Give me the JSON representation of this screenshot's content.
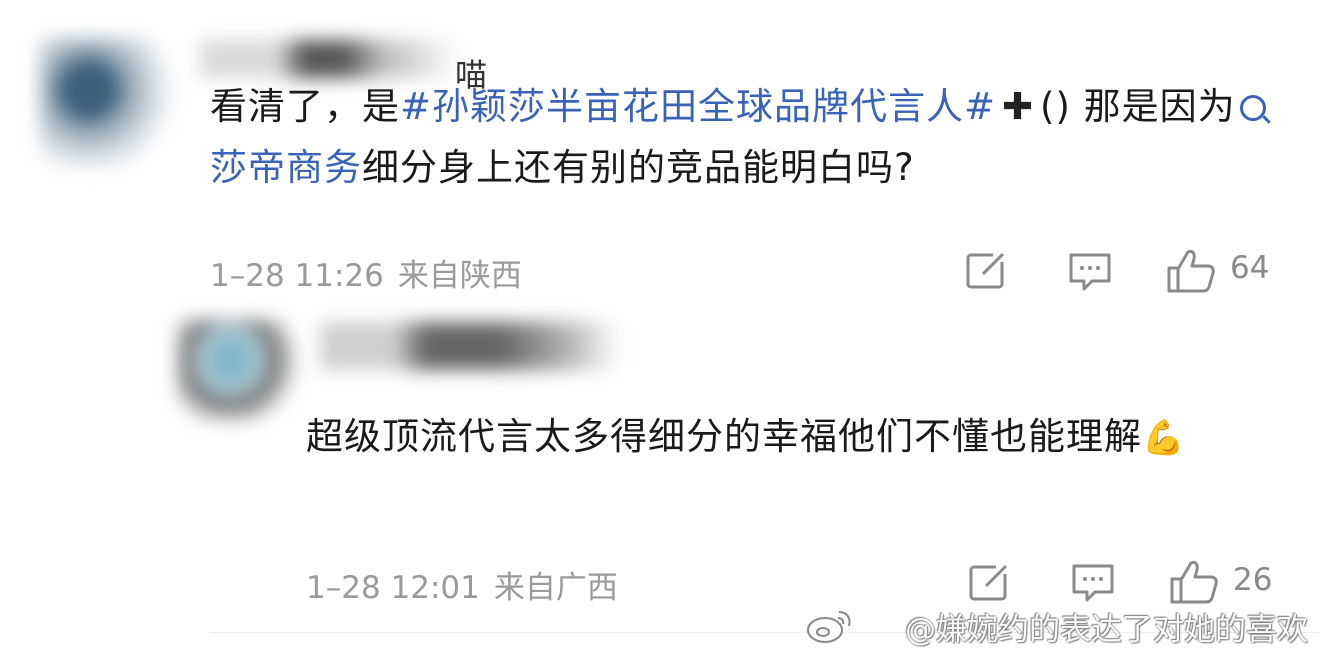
{
  "comments": [
    {
      "username_partial": "喵",
      "text_segments": {
        "prefix": "看清了，是",
        "hashtag": "#孙颖莎半亩花田全球品牌代言人#",
        "plus": "✚",
        "mid": "() 那是因为",
        "search_term": "莎帝商务",
        "suffix": "细分身上还有别的竞品能明白吗?"
      },
      "date": "1–28 11:26",
      "location": "来自陕西",
      "like_count": "64"
    },
    {
      "text": "超级顶流代言太多得细分的幸福他们不懂也能理解",
      "emoji": "💪",
      "date": "1–28 12:01",
      "location": "来自广西",
      "like_count": "26"
    }
  ],
  "watermark": "@嫌婉约的表达了对她的喜欢",
  "icons": [
    "share-icon",
    "comment-icon",
    "like-icon",
    "weibo-logo-icon",
    "search-icon"
  ],
  "colors": {
    "link": "#3a63b8",
    "meta": "#9a9a9a"
  }
}
